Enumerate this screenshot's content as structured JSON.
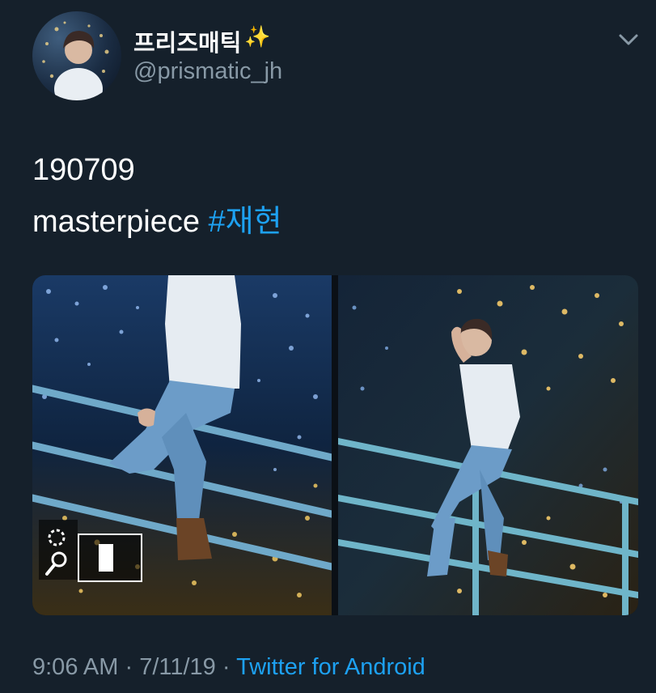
{
  "user": {
    "display_name": "프리즈매틱",
    "emoji": "✨",
    "handle": "@prismatic_jh"
  },
  "tweet": {
    "line1": "190709",
    "line2_text": "masterpiece",
    "hashtag": "#재현"
  },
  "meta": {
    "time": "9:06 AM",
    "separator": "·",
    "date": "7/11/19",
    "source": "Twitter for Android"
  },
  "colors": {
    "background": "#15202b",
    "link": "#1da1f2",
    "secondary_text": "#8899a6"
  },
  "icons": {
    "menu": "chevron-down-icon",
    "sparkles": "sparkles-icon"
  }
}
